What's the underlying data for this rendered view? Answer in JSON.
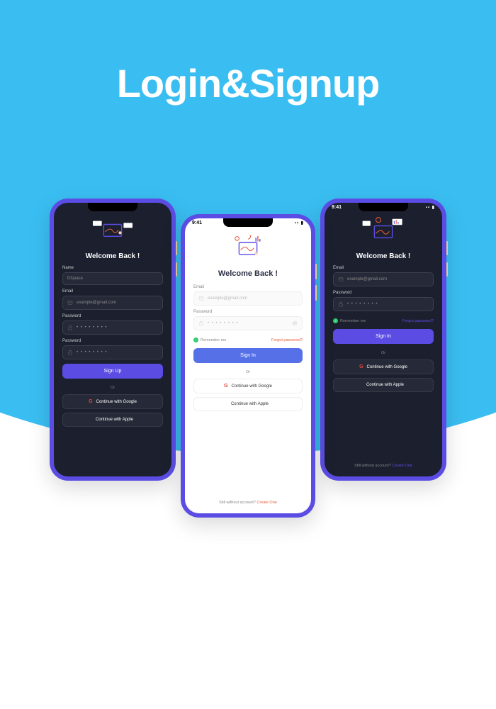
{
  "title": "Login&Signup",
  "status_time": "9:41",
  "status_icons": "▪▪ ▮",
  "welcome_text": "Welcome Back !",
  "or_text": "Or",
  "footer_text": "Still without account?",
  "footer_link": "Create One",
  "left": {
    "fields": {
      "name_label": "Name",
      "name_value": "Dfspace",
      "email_label": "Email",
      "email_placeholder": "example@gmail.com",
      "password_label": "Password",
      "password_value": "• • • • • • • •",
      "password2_label": "Password",
      "password2_value": "• • • • • • • •"
    },
    "signup_label": "Sign Up",
    "google_label": "Continue with Google",
    "apple_label": "Continue with Apple"
  },
  "center": {
    "fields": {
      "email_label": "Email",
      "email_placeholder": "example@gmail.com",
      "password_label": "Password",
      "password_value": "• • • • • • • •"
    },
    "remember_label": "Remember me",
    "forgot_label": "Forgot password?",
    "signin_label": "Sign In",
    "google_label": "Continue with Google",
    "apple_label": "Continue with Apple"
  },
  "right": {
    "fields": {
      "email_label": "Email",
      "email_placeholder": "example@gmail.com",
      "password_label": "Password",
      "password_value": "• • • • • • • •"
    },
    "remember_label": "Remember me",
    "forgot_label": "Forgot password?",
    "signin_label": "Sign In",
    "google_label": "Continue with Google",
    "apple_label": "Continue with Apple"
  }
}
